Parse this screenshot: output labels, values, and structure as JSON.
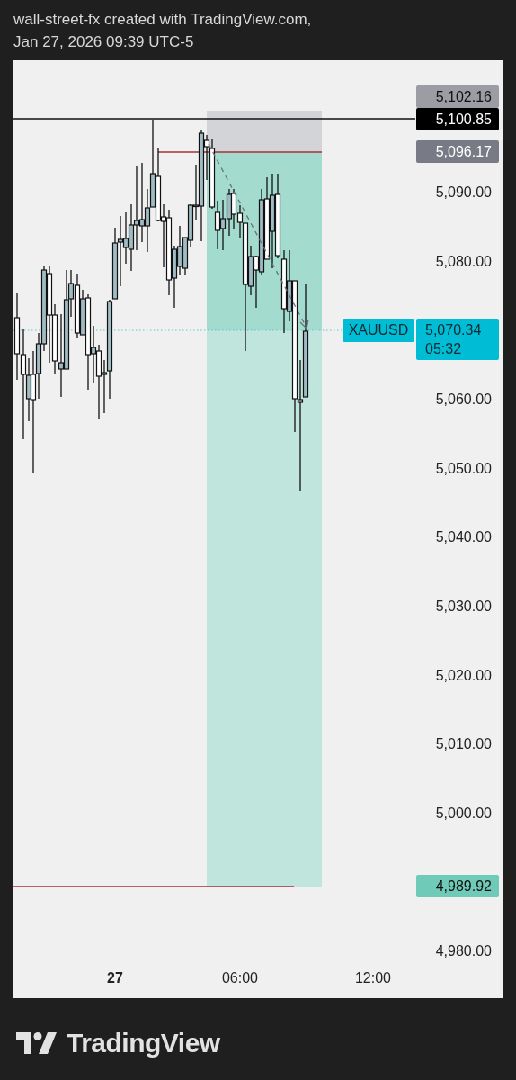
{
  "header": {
    "lines": [
      "wall-street-fx created with TradingView.com,",
      "Jan 27, 2026 09:39 UTC-5"
    ]
  },
  "price_tags": [
    {
      "kind": "target-top",
      "text": "5,102.16"
    },
    {
      "kind": "level",
      "text": "5,100.85"
    },
    {
      "kind": "entry",
      "text": "5,096.17"
    },
    {
      "kind": "stop",
      "text": "4,989.92"
    }
  ],
  "price_axis": [
    "5,090.00",
    "5,080.00",
    "5,060.00",
    "5,050.00",
    "5,040.00",
    "5,030.00",
    "5,020.00",
    "5,010.00",
    "5,000.00",
    "4,980.00"
  ],
  "symbol_tag": {
    "symbol": "XAUUSD",
    "price": "5,070.34",
    "countdown": "05:32"
  },
  "time_axis": [
    {
      "kind": "day",
      "text": "27"
    },
    {
      "kind": "time",
      "text": "06:00"
    },
    {
      "kind": "time",
      "text": "12:00"
    }
  ],
  "footer": {
    "brand": "TradingView"
  }
}
